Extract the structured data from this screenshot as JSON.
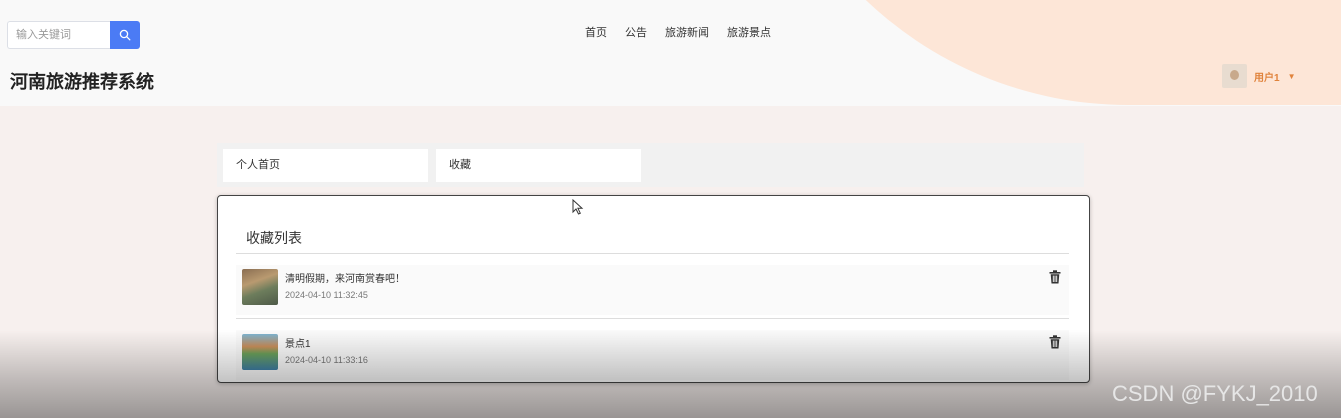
{
  "header": {
    "search": {
      "placeholder": "输入关键词",
      "value": ""
    },
    "nav": [
      "首页",
      "公告",
      "旅游新闻",
      "旅游景点"
    ],
    "site_title": "河南旅游推荐系统",
    "user": {
      "name": "用户1"
    }
  },
  "tabs": [
    "个人首页",
    "收藏"
  ],
  "favorites": {
    "title": "收藏列表",
    "items": [
      {
        "title": "清明假期，来河南赏春吧！",
        "date": "2024-04-10 11:32:45"
      },
      {
        "title": "景点1",
        "date": "2024-04-10 11:33:16"
      }
    ]
  },
  "watermark": "CSDN @FYKJ_2010",
  "colors": {
    "accent": "#4b7bf5",
    "user": "#e0833c",
    "blob": "#fde6d7"
  },
  "icons": {
    "search": "search-icon",
    "delete": "trash-icon",
    "user_menu": "caret-down-icon"
  }
}
